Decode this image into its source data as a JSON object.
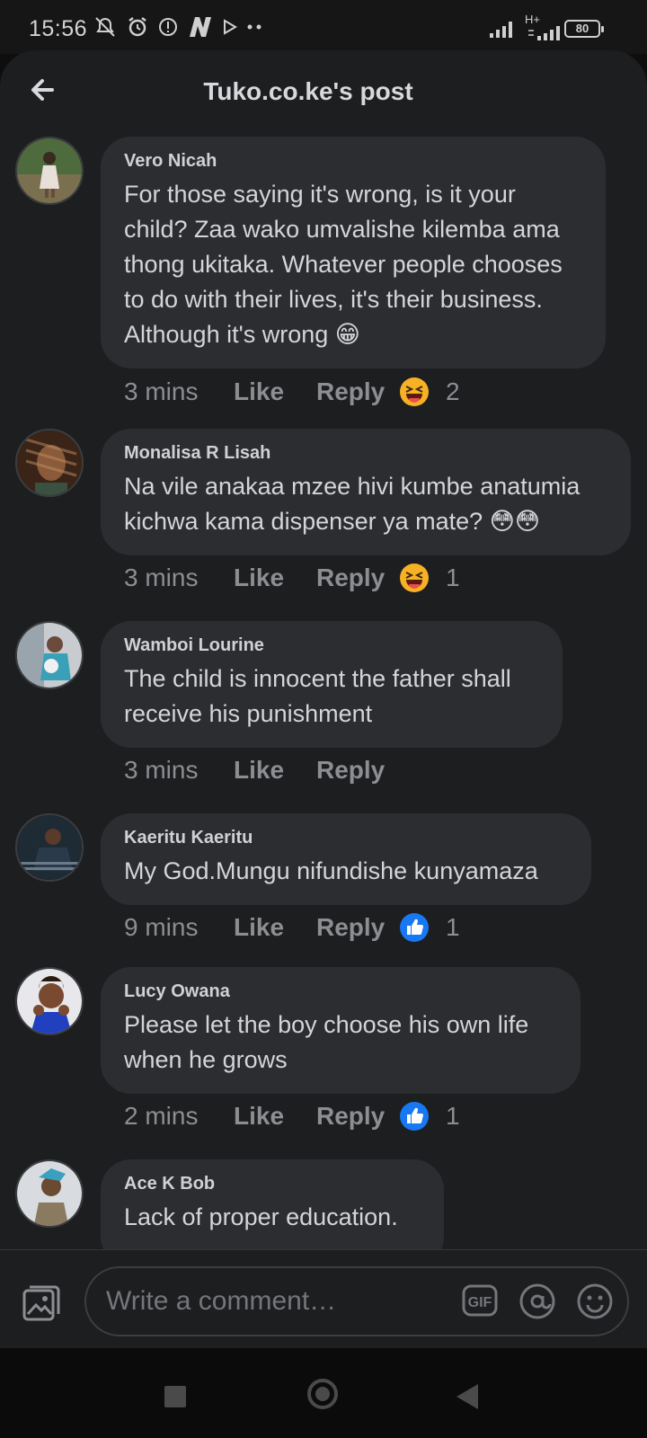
{
  "status_bar": {
    "time": "15:56",
    "battery": "80",
    "network": "H+"
  },
  "header": {
    "title": "Tuko.co.ke's post"
  },
  "comments": [
    {
      "author": "Vero Nicah",
      "text": "For those saying it's wrong, is it your child? Zaa wako umvalishe kilemba ama thong ukitaka. Whatever people chooses to do with their lives, it's their business. Although it's wrong 😁",
      "time": "3 mins",
      "like": "Like",
      "reply": "Reply",
      "reaction": "haha",
      "reaction_count": "2"
    },
    {
      "author": "Monalisa R Lisah",
      "text": "Na vile anakaa mzee hivi kumbe anatumia kichwa kama dispenser ya mate? 😳😳",
      "time": "3 mins",
      "like": "Like",
      "reply": "Reply",
      "reaction": "haha",
      "reaction_count": "1"
    },
    {
      "author": "Wamboi Lourine",
      "text": "The child is innocent the father shall receive his punishment",
      "time": "3 mins",
      "like": "Like",
      "reply": "Reply"
    },
    {
      "author": "Kaeritu Kaeritu",
      "text": "My God.Mungu nifundishe kunyamaza",
      "time": "9 mins",
      "like": "Like",
      "reply": "Reply",
      "reaction": "like",
      "reaction_count": "1"
    },
    {
      "author": "Lucy Owana",
      "text": "Please let the boy choose his own life when he grows",
      "time": "2 mins",
      "like": "Like",
      "reply": "Reply",
      "reaction": "like",
      "reaction_count": "1"
    },
    {
      "author": "Ace K Bob",
      "text": "Lack of proper education."
    }
  ],
  "composer": {
    "placeholder": "Write a comment…"
  },
  "colors": {
    "background": "#1d1e20",
    "bubble": "#2c2d30",
    "like_blue": "#1877f2",
    "haha_yellow": "#f7b125"
  }
}
